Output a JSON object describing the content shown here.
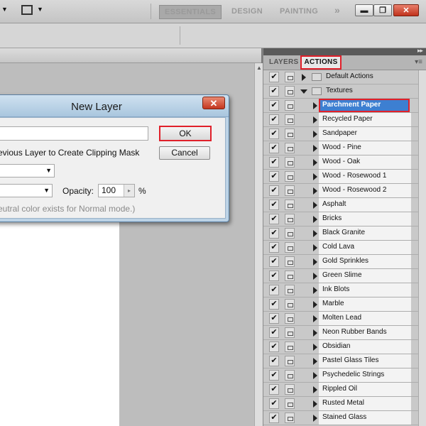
{
  "workspace": {
    "essentials": "ESSENTIALS",
    "design": "DESIGN",
    "painting": "PAINTING",
    "more": "»"
  },
  "window": {
    "minimize": "▬",
    "restore": "❐",
    "close": "✕"
  },
  "dialog": {
    "title": "New Layer",
    "close": "✕",
    "ok_label": "OK",
    "cancel_label": "Cancel",
    "clipping_text": "evious Layer to Create Clipping Mask",
    "opacity_label": "Opacity:",
    "opacity_value": "100",
    "percent": "%",
    "neutral_text": "eutral color exists for Normal mode.)"
  },
  "panel": {
    "tab_layers": "LAYERS",
    "tab_actions": "ACTIONS",
    "folders": [
      {
        "label": "Default Actions",
        "expanded": false
      },
      {
        "label": "Textures",
        "expanded": true
      }
    ],
    "selected_action": "Parchment Paper",
    "actions": [
      "Recycled Paper",
      "Sandpaper",
      "Wood - Pine",
      "Wood - Oak",
      "Wood - Rosewood 1",
      "Wood - Rosewood 2",
      "Asphalt",
      "Bricks",
      "Black Granite",
      "Cold Lava",
      "Gold Sprinkles",
      "Green Slime",
      "Ink Blots",
      "Marble",
      "Molten Lead",
      "Neon Rubber Bands",
      "Obsidian",
      "Pastel Glass Tiles",
      "Psychedelic Strings",
      "Rippled Oil",
      "Rusted Metal",
      "Stained Glass"
    ]
  },
  "colors": {
    "highlight_red": "#e0202a",
    "selection_blue": "#3d7fd1"
  }
}
